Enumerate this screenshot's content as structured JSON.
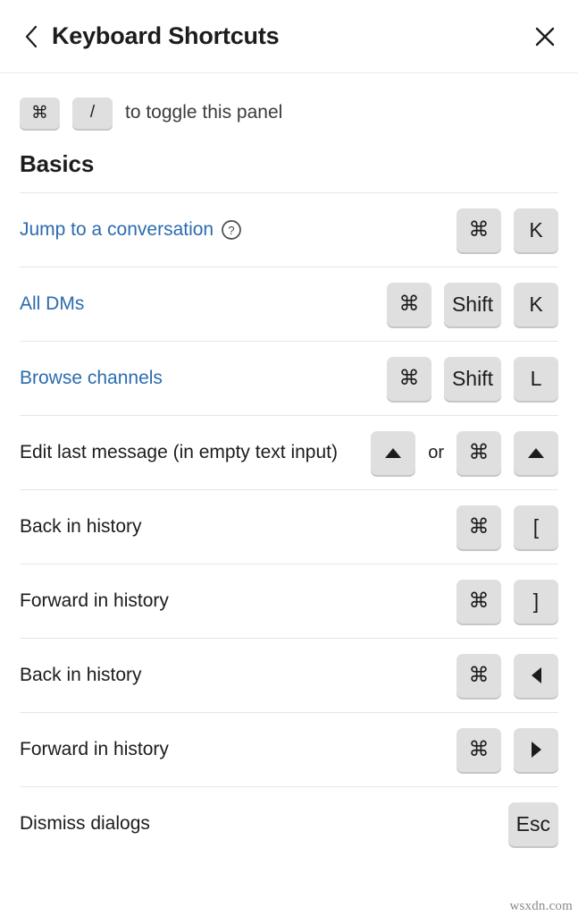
{
  "header": {
    "title": "Keyboard Shortcuts",
    "back_icon": "chevron-left-icon",
    "close_icon": "close-icon"
  },
  "toggle_hint": {
    "keys": [
      "⌘",
      "/"
    ],
    "text": "to toggle this panel"
  },
  "section": {
    "title": "Basics"
  },
  "shortcuts": [
    {
      "label": "Jump to a conversation",
      "is_link": true,
      "has_help": true,
      "keys": [
        {
          "type": "cmd",
          "label": "⌘"
        },
        {
          "type": "text",
          "label": "K"
        }
      ]
    },
    {
      "label": "All DMs",
      "is_link": true,
      "has_help": false,
      "keys": [
        {
          "type": "cmd",
          "label": "⌘"
        },
        {
          "type": "text",
          "label": "Shift"
        },
        {
          "type": "text",
          "label": "K"
        }
      ]
    },
    {
      "label": "Browse channels",
      "is_link": true,
      "has_help": false,
      "keys": [
        {
          "type": "cmd",
          "label": "⌘"
        },
        {
          "type": "text",
          "label": "Shift"
        },
        {
          "type": "text",
          "label": "L"
        }
      ]
    },
    {
      "label": "Edit last message (in empty text input)",
      "is_link": false,
      "has_help": false,
      "keys": [
        {
          "type": "arrow-up",
          "label": "▲"
        },
        {
          "type": "separator",
          "label": "or"
        },
        {
          "type": "cmd",
          "label": "⌘"
        },
        {
          "type": "arrow-up",
          "label": "▲"
        }
      ]
    },
    {
      "label": "Back in history",
      "is_link": false,
      "has_help": false,
      "keys": [
        {
          "type": "cmd",
          "label": "⌘"
        },
        {
          "type": "text",
          "label": "["
        }
      ]
    },
    {
      "label": "Forward in history",
      "is_link": false,
      "has_help": false,
      "keys": [
        {
          "type": "cmd",
          "label": "⌘"
        },
        {
          "type": "text",
          "label": "]"
        }
      ]
    },
    {
      "label": "Back in history",
      "is_link": false,
      "has_help": false,
      "keys": [
        {
          "type": "cmd",
          "label": "⌘"
        },
        {
          "type": "arrow-left",
          "label": "◀"
        }
      ]
    },
    {
      "label": "Forward in history",
      "is_link": false,
      "has_help": false,
      "keys": [
        {
          "type": "cmd",
          "label": "⌘"
        },
        {
          "type": "arrow-right",
          "label": "▶"
        }
      ]
    },
    {
      "label": "Dismiss dialogs",
      "is_link": false,
      "has_help": false,
      "keys": [
        {
          "type": "text",
          "label": "Esc"
        }
      ]
    }
  ],
  "watermark": "wsxdn.com",
  "colors": {
    "link": "#2b6cb0",
    "text": "#1d1c1d",
    "key_bg": "#dfdfdf",
    "divider": "#e6e6e6"
  }
}
